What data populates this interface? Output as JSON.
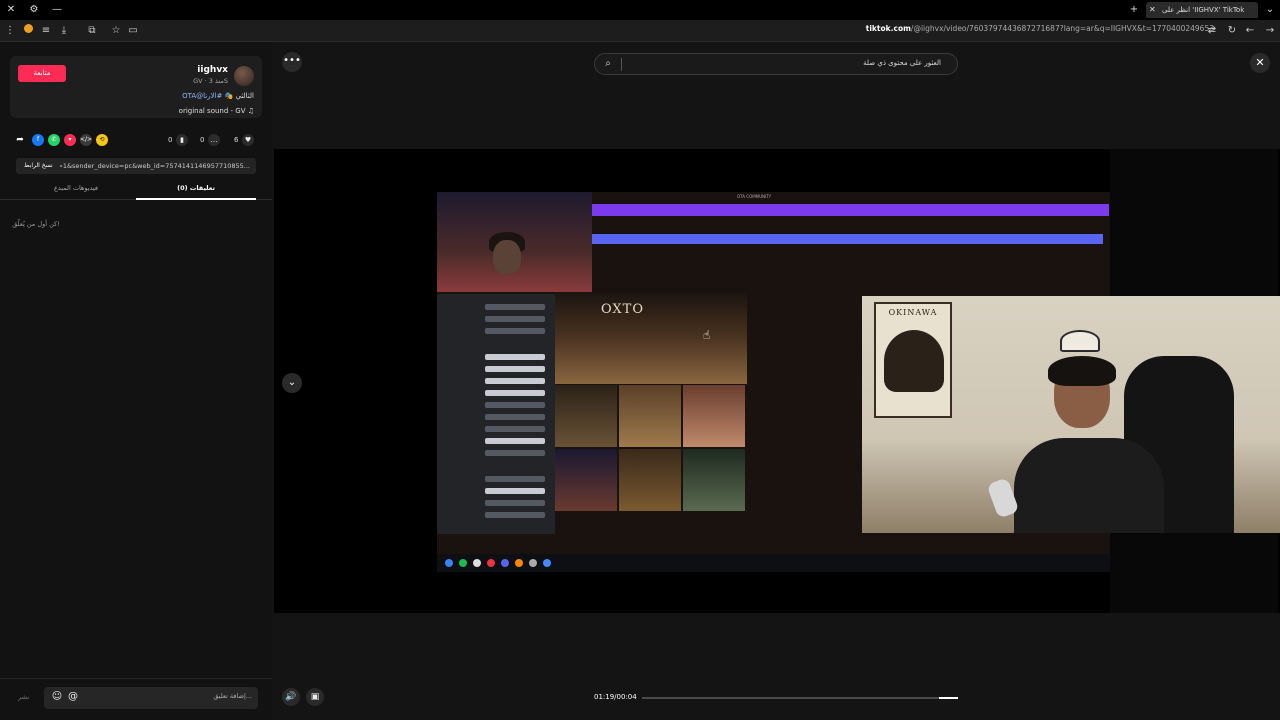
{
  "browser": {
    "tab_title": "انظر على 'IIGHVX' ",
    "tab_title_suffix": "TikTok",
    "url_domain": "tiktok.com",
    "url_path": "/@iighvx/video/7603797443687271687?lang=ar&q=IIGHVX&t=1770400249653"
  },
  "post": {
    "follow_label": "متابعة",
    "username": "iighvx",
    "meta": "GV · منذ 3S",
    "caption_text": "الثالثي 🎭",
    "caption_tags": "#الارتا@OTA",
    "sound": "original sound - GV",
    "likes": "6",
    "comments": "0",
    "saves": "0",
    "copy_label": "نسخ الرابط",
    "link": "...pp=1&sender_device=pc&web_id=7574141146957710855"
  },
  "tabs": {
    "comments": "تعليقات (0)",
    "creator_videos": "فيديوهات المبدع"
  },
  "comments": {
    "empty": "كن أول من يُعلّق!",
    "placeholder": "إضافة تعليق...",
    "post_label": "نشر"
  },
  "player": {
    "search_placeholder": "العثور على محتوى ذي صلة",
    "overlay_title": "OTA COMMUNITY",
    "overlay_sign": "OXTO",
    "poster_title": "OKINAWA",
    "time": "01:19/00:04",
    "progress": 0.06
  },
  "colors": {
    "accent": "#fe2c55",
    "discord_purple": "#7c3aed",
    "discord_blue": "#5865f2"
  }
}
